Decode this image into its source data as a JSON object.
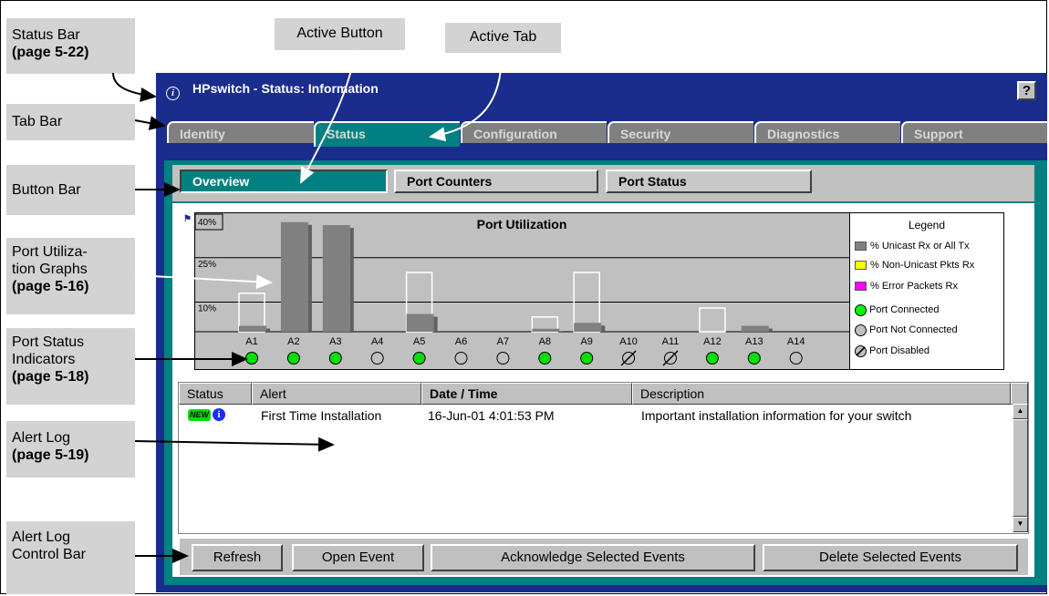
{
  "callouts": {
    "status_bar": [
      "Status Bar",
      "(page 5-22)"
    ],
    "tab_bar": "Tab Bar",
    "button_bar": "Button Bar",
    "port_util": [
      "Port Utiliza-",
      "tion Graphs",
      "(page 5-16)"
    ],
    "port_status": [
      "Port Status",
      "Indicators",
      "(page 5-18)"
    ],
    "alert_log": [
      "Alert Log",
      "(page 5-19)"
    ],
    "alert_ctrl": [
      "Alert Log",
      "Control Bar"
    ],
    "active_button": "Active Button",
    "active_tab": "Active Tab"
  },
  "window": {
    "title": "HPswitch - Status: Information",
    "help_label": "?"
  },
  "tabs": [
    "Identity",
    "Status",
    "Configuration",
    "Security",
    "Diagnostics",
    "Support"
  ],
  "active_tab": "Status",
  "buttons": [
    "Overview",
    "Port Counters",
    "Port Status"
  ],
  "active_button": "Overview",
  "chart_data": {
    "type": "bar",
    "title": "Port Utilization",
    "ylabel": "",
    "tick_labels": [
      "40%",
      "25%",
      "10%"
    ],
    "ylim": [
      0,
      40
    ],
    "categories": [
      "A1",
      "A2",
      "A3",
      "A4",
      "A5",
      "A6",
      "A7",
      "A8",
      "A9",
      "A10",
      "A11",
      "A12",
      "A13",
      "A14"
    ],
    "series": [
      {
        "name": "% Unicast Rx or All Tx",
        "values": [
          2,
          37,
          36,
          0,
          6,
          0,
          0,
          1,
          3,
          0,
          0,
          0,
          2,
          0
        ],
        "color": "#808080"
      }
    ],
    "outlines": [
      13,
      0,
      0,
      0,
      20,
      0,
      0,
      5,
      20,
      0,
      0,
      8,
      0,
      0
    ],
    "port_status": [
      "connected",
      "connected",
      "connected",
      "not_connected",
      "connected",
      "not_connected",
      "not_connected",
      "connected",
      "connected",
      "disabled",
      "disabled",
      "connected",
      "connected",
      "not_connected"
    ],
    "legend": {
      "title": "Legend",
      "items": [
        {
          "label": "% Unicast Rx or All Tx",
          "color": "#808080",
          "kind": "square"
        },
        {
          "label": "% Non-Unicast Pkts Rx",
          "color": "#ffff00",
          "kind": "square"
        },
        {
          "label": "% Error Packets Rx",
          "color": "#ff00ff",
          "kind": "square"
        },
        {
          "label": "Port Connected",
          "color": "#00ff00",
          "kind": "circle"
        },
        {
          "label": "Port Not Connected",
          "color": "#c0c0c0",
          "kind": "circle"
        },
        {
          "label": "Port Disabled",
          "color": "#c0c0c0",
          "kind": "disabled"
        }
      ]
    }
  },
  "alert_log": {
    "headers": [
      "Status",
      "Alert",
      "Date / Time",
      "Description"
    ],
    "rows": [
      {
        "badge": "NEW",
        "alert": "First Time Installation",
        "date": "16-Jun-01 4:01:53 PM",
        "description": "Important installation information for your switch"
      }
    ]
  },
  "controls": [
    "Refresh",
    "Open Event",
    "Acknowledge Selected Events",
    "Delete Selected Events"
  ]
}
